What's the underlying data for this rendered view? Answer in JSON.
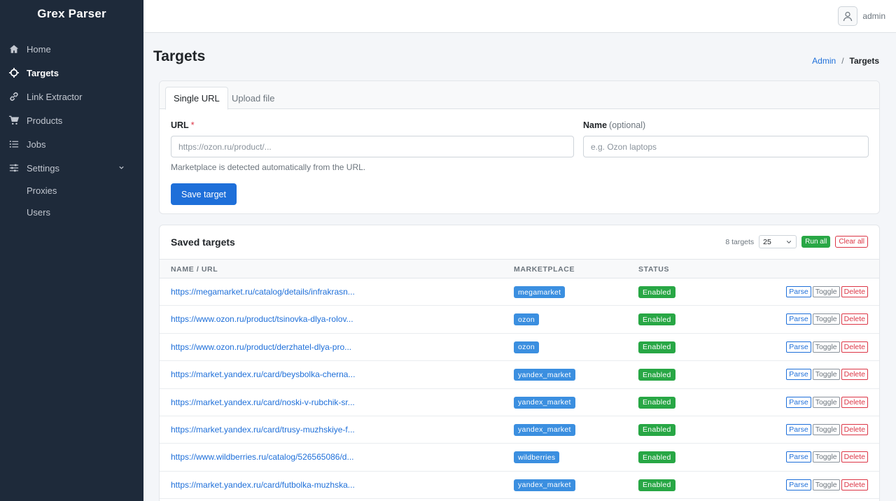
{
  "app": {
    "brand": "Grex Parser"
  },
  "sidebar": {
    "items": [
      {
        "label": "Home",
        "icon": "home-icon"
      },
      {
        "label": "Targets",
        "icon": "crosshair-icon",
        "active": true
      },
      {
        "label": "Link Extractor",
        "icon": "link-icon"
      },
      {
        "label": "Products",
        "icon": "cart-icon"
      },
      {
        "label": "Jobs",
        "icon": "list-icon"
      },
      {
        "label": "Settings",
        "icon": "sliders-icon"
      }
    ],
    "sub_items": [
      {
        "label": "Proxies"
      },
      {
        "label": "Users"
      }
    ]
  },
  "topbar": {
    "user": "admin"
  },
  "page": {
    "title": "Targets"
  },
  "breadcrumb": {
    "parent": "Admin",
    "separator": "/",
    "current": "Targets"
  },
  "form": {
    "tabs": [
      "Single URL",
      "Upload file"
    ],
    "url_label": "URL",
    "url_required": "*",
    "url_placeholder": "https://ozon.ru/product/...",
    "name_label": "Name",
    "name_optional": "(optional)",
    "name_placeholder": "e.g. Ozon laptops",
    "hint": "Marketplace is detected automatically from the URL.",
    "save_label": "Save target"
  },
  "list": {
    "title": "Saved targets",
    "count": "8 targets",
    "page_size": "25",
    "run_all": "Run all",
    "clear_all": "Clear all",
    "columns": [
      "NAME / URL",
      "MARKETPLACE",
      "STATUS"
    ],
    "actions": {
      "parse": "Parse",
      "toggle": "Toggle",
      "delete": "Delete"
    },
    "rows": [
      {
        "url": "https://megamarket.ru/catalog/details/infrakrasn...",
        "marketplace": "megamarket",
        "status": "Enabled"
      },
      {
        "url": "https://www.ozon.ru/product/tsinovka-dlya-rolov...",
        "marketplace": "ozon",
        "status": "Enabled"
      },
      {
        "url": "https://www.ozon.ru/product/derzhatel-dlya-pro...",
        "marketplace": "ozon",
        "status": "Enabled"
      },
      {
        "url": "https://market.yandex.ru/card/beysbolka-cherna...",
        "marketplace": "yandex_market",
        "status": "Enabled"
      },
      {
        "url": "https://market.yandex.ru/card/noski-v-rubchik-sr...",
        "marketplace": "yandex_market",
        "status": "Enabled"
      },
      {
        "url": "https://market.yandex.ru/card/trusy-muzhskiye-f...",
        "marketplace": "yandex_market",
        "status": "Enabled"
      },
      {
        "url": "https://www.wildberries.ru/catalog/526565086/d...",
        "marketplace": "wildberries",
        "status": "Enabled"
      },
      {
        "url": "https://market.yandex.ru/card/futbolka-muzhska...",
        "marketplace": "yandex_market",
        "status": "Enabled"
      }
    ]
  },
  "colors": {
    "sidebar_bg": "#1e2a3a",
    "primary": "#1e6fd9",
    "success": "#28a745",
    "danger": "#dc3545"
  }
}
